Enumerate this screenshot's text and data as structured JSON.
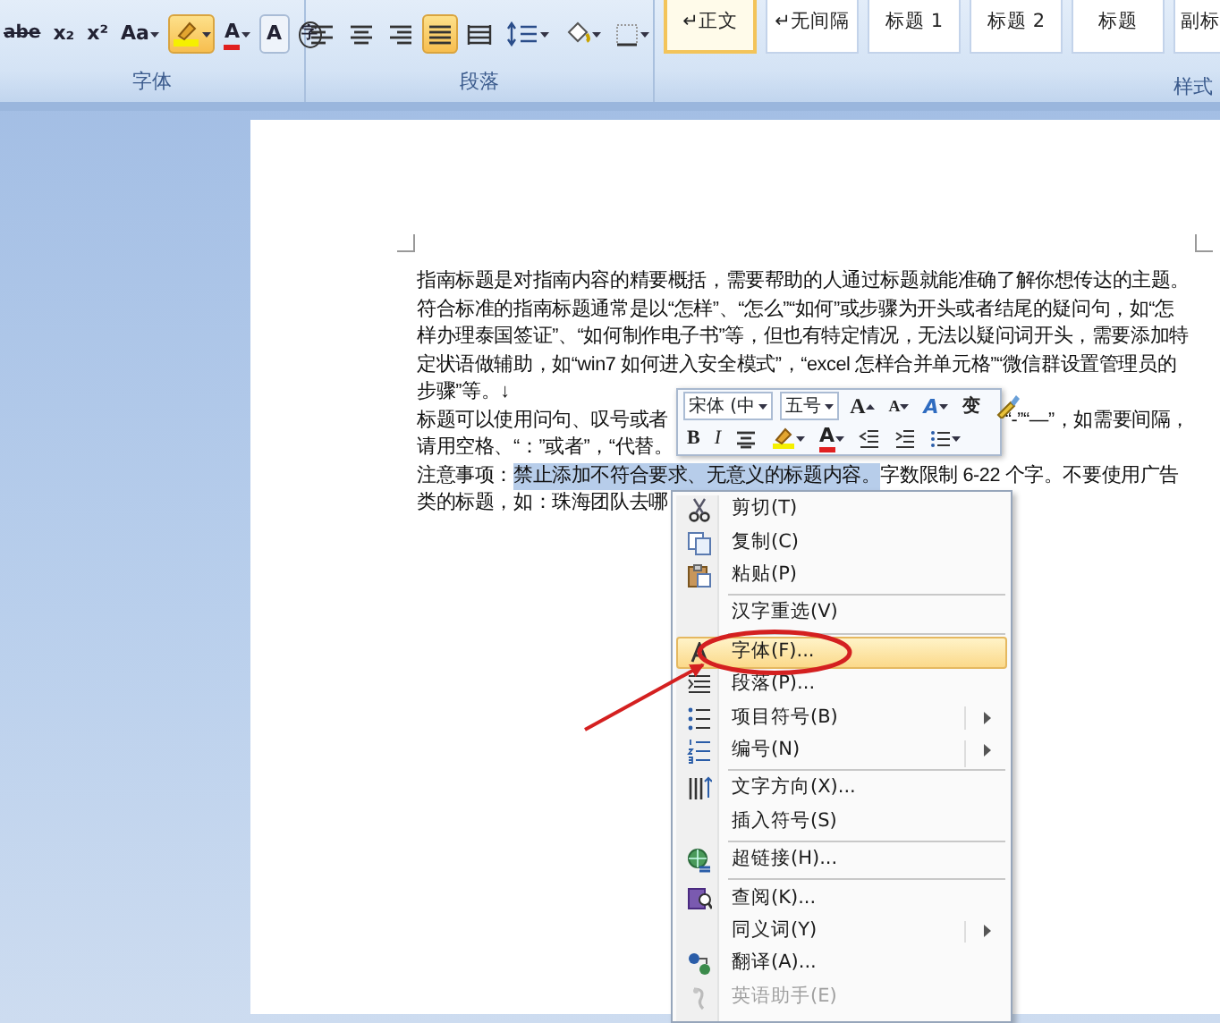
{
  "ribbon": {
    "font_group": {
      "label": "字体",
      "buttons": [
        {
          "kind": "strike",
          "glyph": "abe",
          "dropdown": false
        },
        {
          "kind": "text",
          "glyph": "x₂",
          "dropdown": false
        },
        {
          "kind": "text",
          "glyph": "x²",
          "dropdown": false
        },
        {
          "kind": "text",
          "glyph": "Aa",
          "dropdown": true
        },
        {
          "kind": "highlight",
          "dropdown": true
        },
        {
          "kind": "fontcolor",
          "glyph": "A",
          "dropdown": true
        },
        {
          "kind": "shade",
          "glyph": "A",
          "dropdown": false
        },
        {
          "kind": "circle",
          "glyph": "字",
          "dropdown": false
        }
      ]
    },
    "paragraph_group": {
      "label": "段落",
      "buttons": [
        {
          "kind": "align-left",
          "selected": false
        },
        {
          "kind": "align-center",
          "selected": false
        },
        {
          "kind": "align-right",
          "selected": false
        },
        {
          "kind": "justify",
          "selected": true
        },
        {
          "kind": "distribute",
          "selected": false
        },
        {
          "kind": "line-spacing",
          "selected": false
        },
        {
          "kind": "shading",
          "selected": false
        },
        {
          "kind": "borders",
          "selected": false
        }
      ]
    },
    "styles_group": {
      "label": "样式",
      "items": [
        {
          "label": "↵正文",
          "selected": true
        },
        {
          "label": "↵无间隔",
          "selected": false
        },
        {
          "label": "标题 1",
          "selected": false
        },
        {
          "label": "标题 2",
          "selected": false
        },
        {
          "label": "标题",
          "selected": false
        },
        {
          "label": "副标",
          "selected": false
        }
      ]
    }
  },
  "document": {
    "lines": [
      {
        "segments": [
          {
            "text": "指南标题是对指南内容的精要概括，需要帮助的人通过标题就能准确了解你想传达的主题。",
            "selected": false
          }
        ]
      },
      {
        "segments": [
          {
            "text": "符合标准的指南标题通常是以“怎样”、“怎么”“如何”或步骤为开头或者结尾的疑问句，如“怎",
            "selected": false
          }
        ]
      },
      {
        "segments": [
          {
            "text": "样办理泰国签证”、“如何制作电子书”等，但也有特定情况，无法以疑问词开头，需要添加特",
            "selected": false
          }
        ]
      },
      {
        "segments": [
          {
            "text": "定状语做辅助，如“win7 如何进入安全模式”，“excel 怎样合并单元格”“微信群设置管理员的",
            "selected": false
          }
        ]
      },
      {
        "segments": [
          {
            "text": "步骤”等。↓",
            "selected": false
          }
        ]
      },
      {
        "segments": [
          {
            "text": "标题可以使用问句、叹号或者",
            "selected": false
          }
        ],
        "right": "“-”“—”，如需要间隔，"
      },
      {
        "segments": [
          {
            "text": "请用空格、“：”或者”，“代替。",
            "selected": false
          }
        ]
      },
      {
        "segments": [
          {
            "text": "注意事项：",
            "selected": false
          },
          {
            "text": "禁止添加不符合要求、无意义的标题内容。",
            "selected": true
          },
          {
            "text": "字数限制 6-22 个字。不要使用广告",
            "selected": false
          }
        ]
      },
      {
        "segments": [
          {
            "text": "类的标题，如：珠海团队去哪",
            "selected": false
          }
        ]
      }
    ]
  },
  "mini_toolbar": {
    "font_name": "宋体 (中",
    "font_size": "五号",
    "row1": [
      {
        "kind": "grow",
        "glyph": "A"
      },
      {
        "kind": "shrink",
        "glyph": "A"
      },
      {
        "kind": "styles",
        "glyph": "A"
      },
      {
        "kind": "phonetic",
        "glyph": "变"
      },
      {
        "kind": "painter"
      }
    ],
    "row2": [
      {
        "kind": "bold",
        "glyph": "B"
      },
      {
        "kind": "italic",
        "glyph": "I"
      },
      {
        "kind": "center"
      },
      {
        "kind": "highlight"
      },
      {
        "kind": "fontcolor",
        "glyph": "A"
      },
      {
        "kind": "outdent"
      },
      {
        "kind": "indent"
      },
      {
        "kind": "bullets"
      }
    ]
  },
  "context_menu": {
    "items": [
      {
        "label": "剪切(T)",
        "highlighted": false,
        "submenu": false,
        "disabled": false,
        "separator_after": false
      },
      {
        "label": "复制(C)",
        "highlighted": false,
        "submenu": false,
        "disabled": false,
        "separator_after": false
      },
      {
        "label": "粘贴(P)",
        "highlighted": false,
        "submenu": false,
        "disabled": false,
        "separator_after": true
      },
      {
        "label": "汉字重选(V)",
        "highlighted": false,
        "submenu": false,
        "disabled": false,
        "separator_after": true
      },
      {
        "label": "字体(F)...",
        "highlighted": true,
        "submenu": false,
        "disabled": false,
        "separator_after": false
      },
      {
        "label": "段落(P)...",
        "highlighted": false,
        "submenu": false,
        "disabled": false,
        "separator_after": false
      },
      {
        "label": "项目符号(B)",
        "highlighted": false,
        "submenu": true,
        "disabled": false,
        "separator_after": false
      },
      {
        "label": "编号(N)",
        "highlighted": false,
        "submenu": true,
        "disabled": false,
        "separator_after": true
      },
      {
        "label": "文字方向(X)...",
        "highlighted": false,
        "submenu": false,
        "disabled": false,
        "separator_after": false
      },
      {
        "label": "插入符号(S)",
        "highlighted": false,
        "submenu": false,
        "disabled": false,
        "separator_after": true
      },
      {
        "label": "超链接(H)...",
        "highlighted": false,
        "submenu": false,
        "disabled": false,
        "separator_after": true
      },
      {
        "label": "查阅(K)...",
        "highlighted": false,
        "submenu": false,
        "disabled": false,
        "separator_after": false
      },
      {
        "label": "同义词(Y)",
        "highlighted": false,
        "submenu": true,
        "disabled": false,
        "separator_after": false
      },
      {
        "label": "翻译(A)...",
        "highlighted": false,
        "submenu": false,
        "disabled": false,
        "separator_after": false
      },
      {
        "label": "英语助手(E)",
        "highlighted": false,
        "submenu": false,
        "disabled": true,
        "separator_after": false
      }
    ]
  }
}
